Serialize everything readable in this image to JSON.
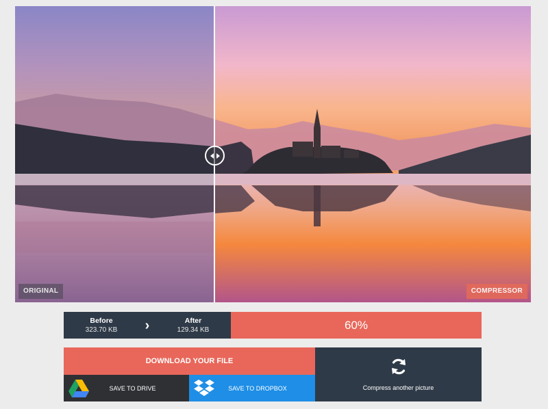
{
  "comparison": {
    "left_label": "ORIGINAL",
    "right_label": "COMPRESSOR",
    "slider_position_percent": 38.7
  },
  "stats": {
    "before_title": "Before",
    "before_size": "323.70 KB",
    "arrow": "›",
    "after_title": "After",
    "after_size": "129.34 KB",
    "reduction": "60%"
  },
  "actions": {
    "download_label": "DOWNLOAD YOUR FILE",
    "drive_label": "SAVE TO DRIVE",
    "dropbox_label": "SAVE TO DROPBOX",
    "another_label": "Compress another picture"
  },
  "icons": {
    "slider": "left-right-arrows-icon",
    "drive": "google-drive-icon",
    "dropbox": "dropbox-icon",
    "another": "refresh-icon"
  },
  "colors": {
    "accent": "#e8675a",
    "dark_panel": "#2f3a48",
    "drive_bg": "#2f3034",
    "dropbox_bg": "#1e8ee6"
  }
}
